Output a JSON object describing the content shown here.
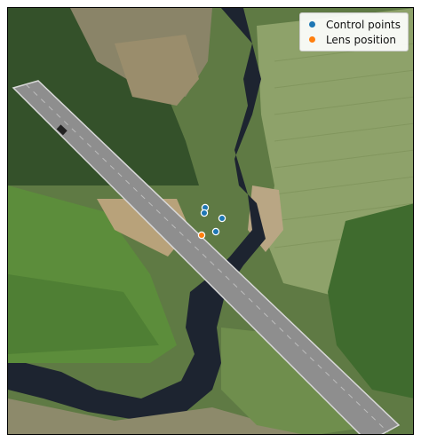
{
  "legend": {
    "control_label": "Control points",
    "lens_label": "Lens position"
  },
  "colors": {
    "control": "#1f77b4",
    "lens": "#ff7f0e",
    "river": "#1d2430",
    "field_light": "#7f9a5c",
    "field_dark": "#39622c",
    "road": "#8e8e8e"
  },
  "map_data": {
    "control_points": [
      {
        "id": "cp1"
      },
      {
        "id": "cp2"
      },
      {
        "id": "cp3"
      },
      {
        "id": "cp4"
      }
    ],
    "lens_position": {
      "id": "lens"
    }
  }
}
